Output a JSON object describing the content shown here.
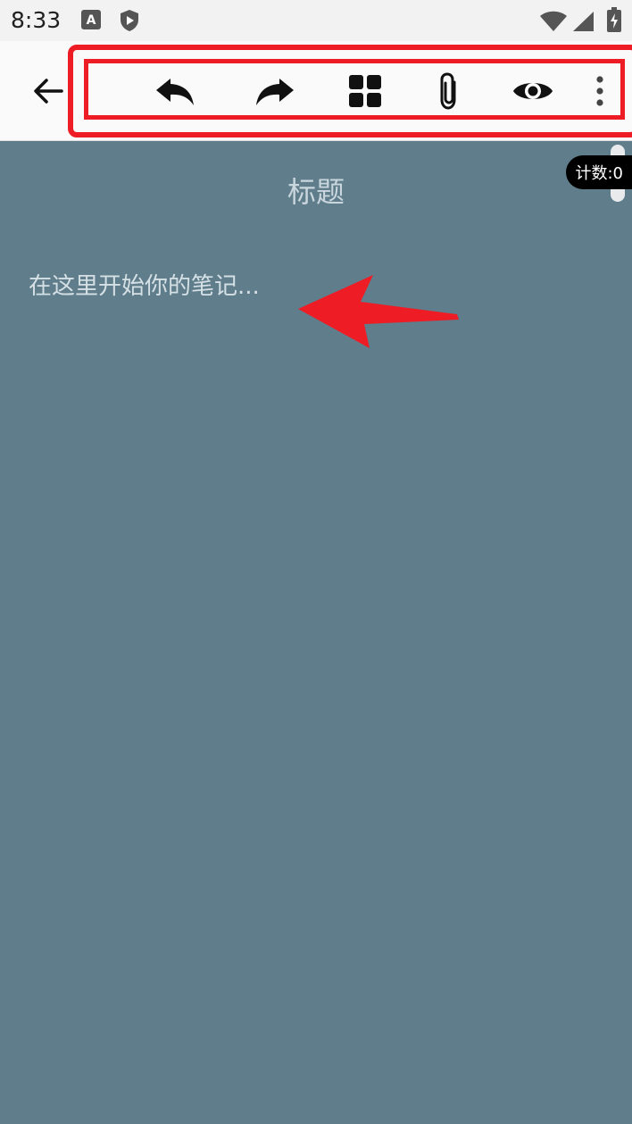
{
  "status_bar": {
    "time": "8:33",
    "icons": [
      "font-a-icon",
      "shield-play-icon",
      "wifi-icon",
      "signal-icon",
      "battery-charging-icon"
    ]
  },
  "app_bar": {
    "back_icon": "arrow-left-icon",
    "toolbar": [
      {
        "name": "undo-button",
        "icon": "undo-icon"
      },
      {
        "name": "redo-button",
        "icon": "redo-icon"
      },
      {
        "name": "categories-button",
        "icon": "grid-icon"
      },
      {
        "name": "attach-button",
        "icon": "paperclip-icon"
      },
      {
        "name": "preview-button",
        "icon": "eye-icon"
      },
      {
        "name": "more-button",
        "icon": "more-vert-icon"
      }
    ]
  },
  "editor": {
    "title_placeholder": "标题",
    "body_placeholder": "在这里开始你的笔记...",
    "counter": "计数:0"
  },
  "colors": {
    "background": "#607d8b",
    "highlight": "#ee1c25",
    "app_bar": "#fafafa"
  }
}
